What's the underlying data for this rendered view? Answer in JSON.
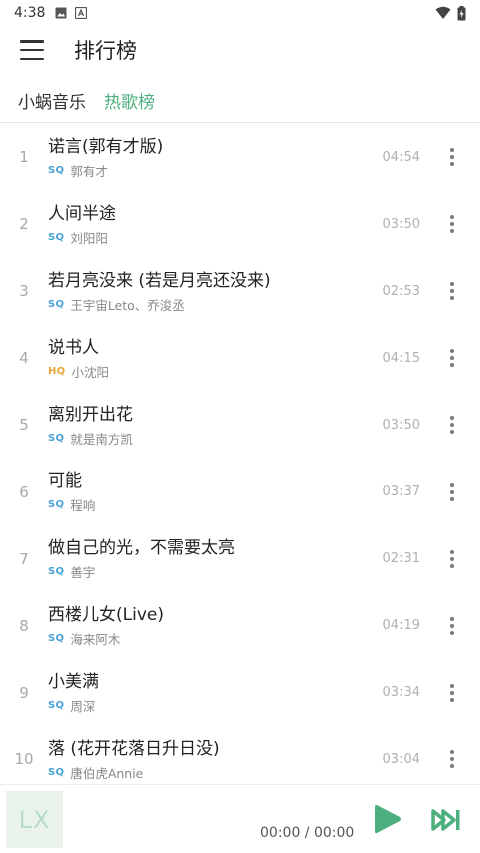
{
  "status": {
    "time": "4:38"
  },
  "app_bar": {
    "title": "排行榜"
  },
  "sources": [
    {
      "label": "小蜗音乐"
    },
    {
      "label": "热歌榜"
    }
  ],
  "accent_color": "#4caf7d",
  "songs": [
    {
      "index": "1",
      "title": "诺言(郭有才版)",
      "quality": "SQ",
      "artist": "郭有才",
      "duration": "04:54"
    },
    {
      "index": "2",
      "title": "人间半途",
      "quality": "SQ",
      "artist": "刘阳阳",
      "duration": "03:50"
    },
    {
      "index": "3",
      "title": "若月亮没来 (若是月亮还没来)",
      "quality": "SQ",
      "artist": "王宇宙Leto、乔浚丞",
      "duration": "02:53"
    },
    {
      "index": "4",
      "title": "说书人",
      "quality": "HQ",
      "artist": "小沈阳",
      "duration": "04:15"
    },
    {
      "index": "5",
      "title": "离别开出花",
      "quality": "SQ",
      "artist": "就是南方凯",
      "duration": "03:50"
    },
    {
      "index": "6",
      "title": "可能",
      "quality": "SQ",
      "artist": "程响",
      "duration": "03:37"
    },
    {
      "index": "7",
      "title": "做自己的光，不需要太亮",
      "quality": "SQ",
      "artist": "善宇",
      "duration": "02:31"
    },
    {
      "index": "8",
      "title": "西楼儿女(Live)",
      "quality": "SQ",
      "artist": "海来阿木",
      "duration": "04:19"
    },
    {
      "index": "9",
      "title": "小美满",
      "quality": "SQ",
      "artist": "周深",
      "duration": "03:34"
    },
    {
      "index": "10",
      "title": "落 (花开花落日升日没)",
      "quality": "SQ",
      "artist": "唐伯虎Annie",
      "duration": "03:04"
    }
  ],
  "player": {
    "cover_text": "LX",
    "time": "00:00 / 00:00"
  }
}
